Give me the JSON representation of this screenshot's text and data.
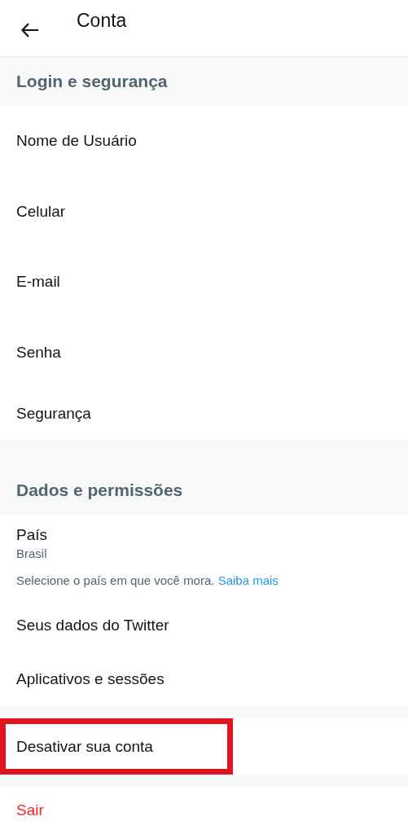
{
  "header": {
    "title": "Conta"
  },
  "sections": [
    {
      "title": "Login e segurança",
      "items": [
        {
          "kind": "plain",
          "label": "Nome de Usuário"
        },
        {
          "kind": "plain",
          "label": "Celular"
        },
        {
          "kind": "plain",
          "label": "E-mail"
        },
        {
          "kind": "plain",
          "label": "Senha"
        },
        {
          "kind": "plain",
          "label": "Segurança"
        }
      ]
    },
    {
      "title": "Dados e permissões",
      "items": [
        {
          "kind": "detail",
          "label": "País",
          "value": "Brasil",
          "note": "Selecione o país em que você mora.",
          "link": "Saiba mais"
        },
        {
          "kind": "plain",
          "label": "Seus dados do Twitter"
        },
        {
          "kind": "plain",
          "label": "Aplicativos e sessões"
        }
      ]
    }
  ],
  "account_actions": [
    {
      "label": "Desativar sua conta",
      "highlighted": true
    }
  ],
  "logout": {
    "label": "Sair"
  }
}
